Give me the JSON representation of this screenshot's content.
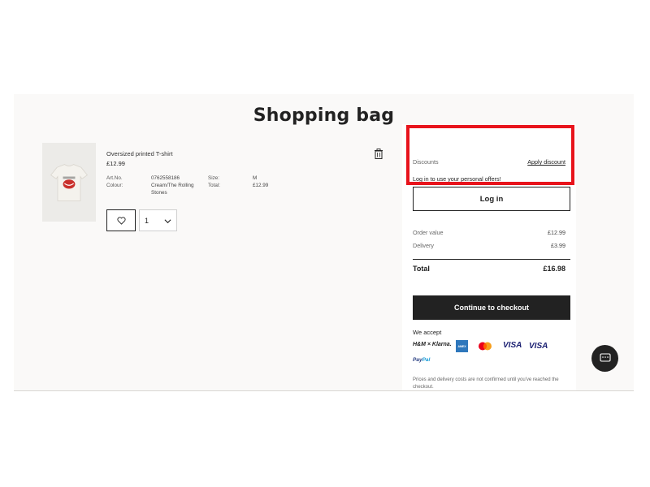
{
  "page": {
    "title": "Shopping bag"
  },
  "product": {
    "name": "Oversized printed T-shirt",
    "price": "£12.99",
    "artno_label": "Art.No.",
    "artno_value": "0762558186",
    "colour_label": "Colour:",
    "colour_value_line1": "Cream/The Rolling",
    "colour_value_line2": "Stones",
    "size_label": "Size:",
    "size_value": "M",
    "total_label": "Total:",
    "total_value": "£12.99",
    "quantity": "1"
  },
  "summary": {
    "discounts_label": "Discounts",
    "apply_discount": "Apply discount",
    "personal_offers": "Log in to use your personal offers!",
    "login_button": "Log in",
    "order_value_label": "Order value",
    "order_value": "£12.99",
    "delivery_label": "Delivery",
    "delivery_value": "£3.99",
    "total_label": "Total",
    "total_value": "£16.98",
    "checkout_button": "Continue to checkout",
    "we_accept": "We accept",
    "payment_methods": {
      "klarna": "H&M × Klarna.",
      "amex": "AMEX",
      "visa1": "VISA",
      "visa2": "VISA",
      "paypal_part1": "Pay",
      "paypal_part2": "Pal"
    },
    "disclaimer": "Prices and delivery costs are not confirmed until you've reached the checkout."
  },
  "colors": {
    "background": "#faf9f8",
    "accent_dark": "#222222",
    "highlight": "#e8141c"
  },
  "icons": [
    "trash-icon",
    "heart-icon",
    "chevron-down-icon",
    "chat-icon",
    "tshirt-image"
  ]
}
